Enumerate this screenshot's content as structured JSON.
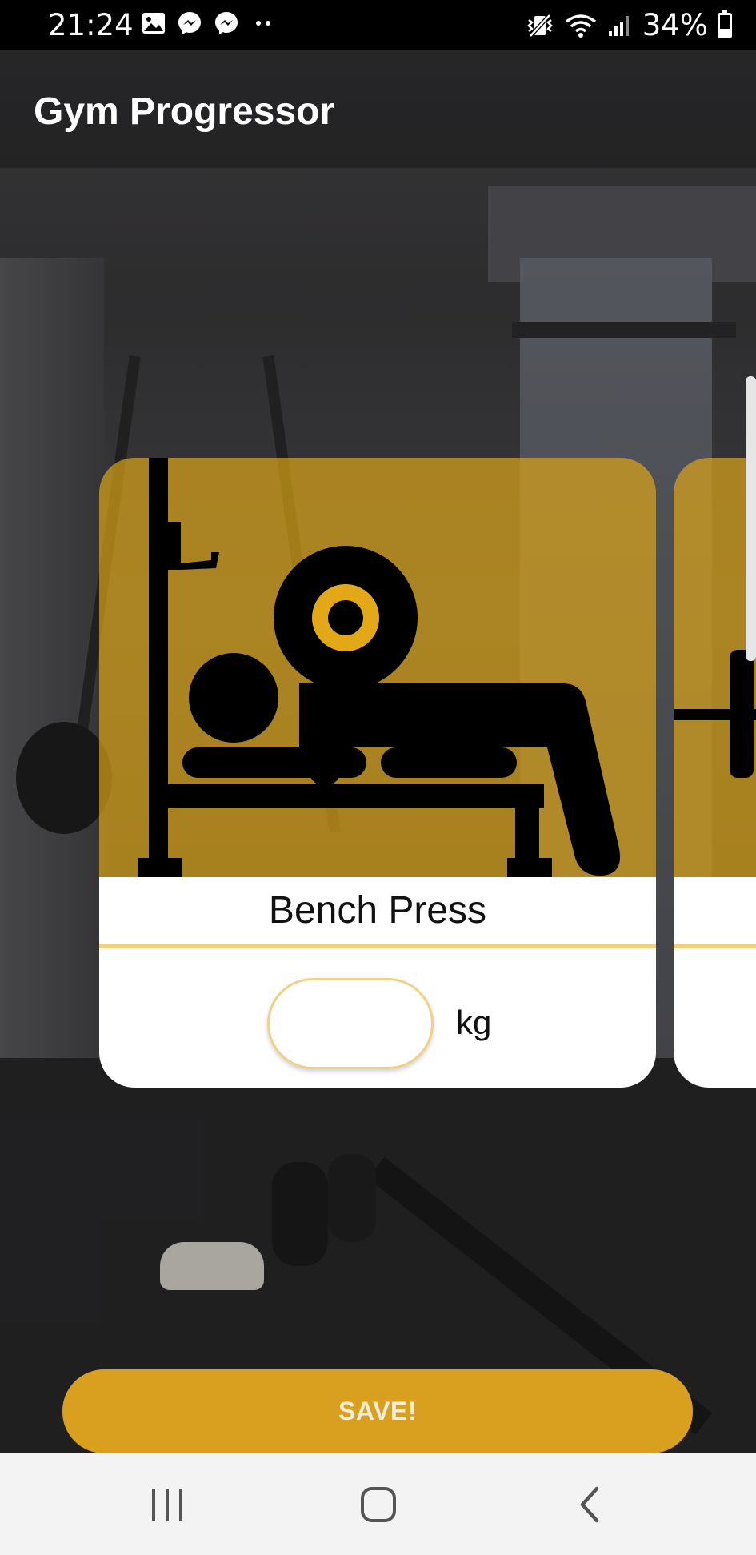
{
  "status_bar": {
    "time": "21:24",
    "battery": "34%",
    "battery_level": 0.34,
    "left_icons": [
      "gallery-icon",
      "messenger-icon",
      "messenger-icon",
      "more-dots-icon"
    ],
    "right_icons": [
      "vibrate-icon",
      "wifi-icon",
      "signal-icon",
      "battery-icon"
    ]
  },
  "app_bar": {
    "title": "Gym Progressor"
  },
  "exercise_card": {
    "title": "Bench Press",
    "image_icon": "bench-press-icon",
    "weight_value": "",
    "weight_placeholder": "",
    "unit": "kg"
  },
  "next_card": {
    "image_icon": "barbell-icon"
  },
  "save_button": {
    "label": "SAVE!"
  },
  "nav_bar": {
    "items": [
      "recent-apps-icon",
      "home-icon",
      "back-icon"
    ]
  },
  "colors": {
    "accent": "#d9a020",
    "card_overlay": "#e2a817",
    "divider": "#f3cf7b",
    "status_bar": "#000000",
    "nav_bar": "#f3f3f3"
  }
}
